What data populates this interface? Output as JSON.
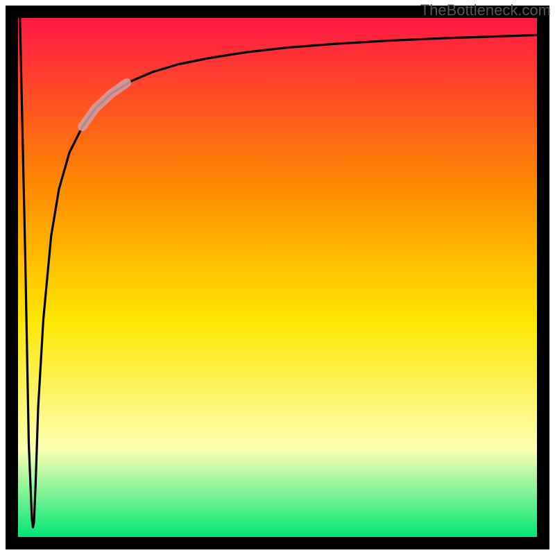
{
  "watermark": "TheBottleneck.com",
  "chart_data": {
    "type": "line",
    "title": "",
    "xlabel": "",
    "ylabel": "",
    "xlim": [
      0,
      100
    ],
    "ylim": [
      0,
      100
    ],
    "background_gradient": {
      "top": "#ff1744",
      "mid_upper": "#ff8c00",
      "mid": "#ffe600",
      "lower": "#fdffb3",
      "bottom": "#00e676"
    },
    "series": [
      {
        "name": "bottleneck-curve",
        "x": [
          0.5,
          1.5,
          2.2,
          2.8,
          3.0,
          3.2,
          3.5,
          4.0,
          5.0,
          6.5,
          8.0,
          10.0,
          12.5,
          15.0,
          18.0,
          22.0,
          26.0,
          31.0,
          37.0,
          44.0,
          52.0,
          61.0,
          71.0,
          82.0,
          94.0,
          100.0
        ],
        "y": [
          100,
          55,
          18,
          3.5,
          2.0,
          3.0,
          10,
          25,
          42,
          58,
          67,
          74,
          79,
          82.5,
          85.3,
          87.8,
          89.5,
          91.0,
          92.2,
          93.3,
          94.2,
          94.9,
          95.5,
          96.0,
          96.4,
          96.6
        ]
      },
      {
        "name": "highlight-segment",
        "x": [
          12.5,
          15.0,
          18.0,
          21.0
        ],
        "y": [
          79.0,
          82.5,
          85.3,
          87.4
        ]
      }
    ],
    "notes": "Axes have no tick labels; black frame with ~18px stroke; gradient fill inside plot area; a single black curve drops steeply to a minimum near the left edge then asymptotically rises toward the top-right; a short semi-transparent thick pinkish overlay sits on the rising part of the curve."
  },
  "colors": {
    "frame": "#000000",
    "curve": "#000000",
    "highlight": "rgba(210,160,165,0.85)"
  }
}
